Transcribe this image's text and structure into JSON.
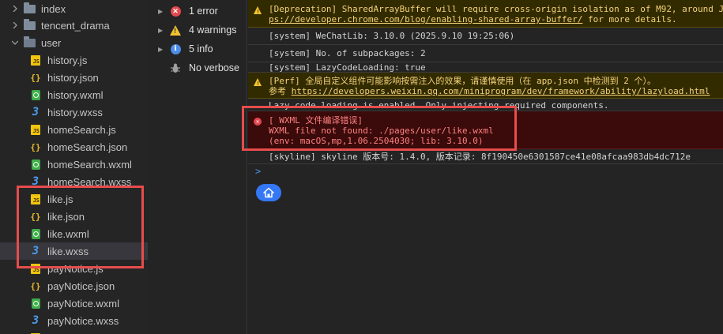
{
  "tree": {
    "folders": [
      {
        "label": "index",
        "open": false
      },
      {
        "label": "tencent_drama",
        "open": false
      },
      {
        "label": "user",
        "open": true
      }
    ],
    "files": [
      {
        "label": "history.js",
        "type": "js"
      },
      {
        "label": "history.json",
        "type": "json"
      },
      {
        "label": "history.wxml",
        "type": "wxml"
      },
      {
        "label": "history.wxss",
        "type": "wxss"
      },
      {
        "label": "homeSearch.js",
        "type": "js"
      },
      {
        "label": "homeSearch.json",
        "type": "json"
      },
      {
        "label": "homeSearch.wxml",
        "type": "wxml"
      },
      {
        "label": "homeSearch.wxss",
        "type": "wxss"
      },
      {
        "label": "like.js",
        "type": "js"
      },
      {
        "label": "like.json",
        "type": "json"
      },
      {
        "label": "like.wxml",
        "type": "wxml"
      },
      {
        "label": "like.wxss",
        "type": "wxss",
        "selected": true
      },
      {
        "label": "payNotice.js",
        "type": "js"
      },
      {
        "label": "payNotice.json",
        "type": "json"
      },
      {
        "label": "payNotice.wxml",
        "type": "wxml"
      },
      {
        "label": "payNotice.wxss",
        "type": "wxss"
      }
    ]
  },
  "filters": {
    "errors": "1 error",
    "warnings": "4 warnings",
    "info": "5 info",
    "verbose": "No verbose"
  },
  "console": {
    "deprecation_line1": "[Deprecation] SharedArrayBuffer will require cross-origin isolation as of M92, around J",
    "deprecation_link": "ps://developer.chrome.com/blog/enabling-shared-array-buffer/",
    "deprecation_tail": " for more details.",
    "wechatlib": "[system] WeChatLib: 3.10.0 (2025.9.10 19:25:06)",
    "subpackages": "[system] No. of subpackages: 2",
    "lazycode": "[system] LazyCodeLoading: true",
    "perf_line1": "[Perf] 全局自定义组件可能影响按需注入的效果，请谨慎使用（在 app.json 中检测到 2 个）。",
    "perf_ref": "参考 ",
    "perf_link": "https://developers.weixin.qq.com/miniprogram/dev/framework/ability/lazyload.html",
    "lazy_enabled": "Lazy code loading is enabled. Only injecting required components.",
    "error_title": "[ WXML 文件编译错误]",
    "error_line2": "WXML file not found: ./pages/user/like.wxml",
    "error_line3": "(env: macOS,mp,1.06.2504030; lib: 3.10.0)",
    "skyline": "[skyline] skyline 版本号: 1.4.0, 版本记录: 8f190450e6301587ce41e08afcaa983db4dc712e",
    "prompt": ">"
  },
  "colors": {
    "annotation": "#e74c4c",
    "error": "#e5484d",
    "warning": "#f4c430",
    "info": "#4c8de8"
  }
}
